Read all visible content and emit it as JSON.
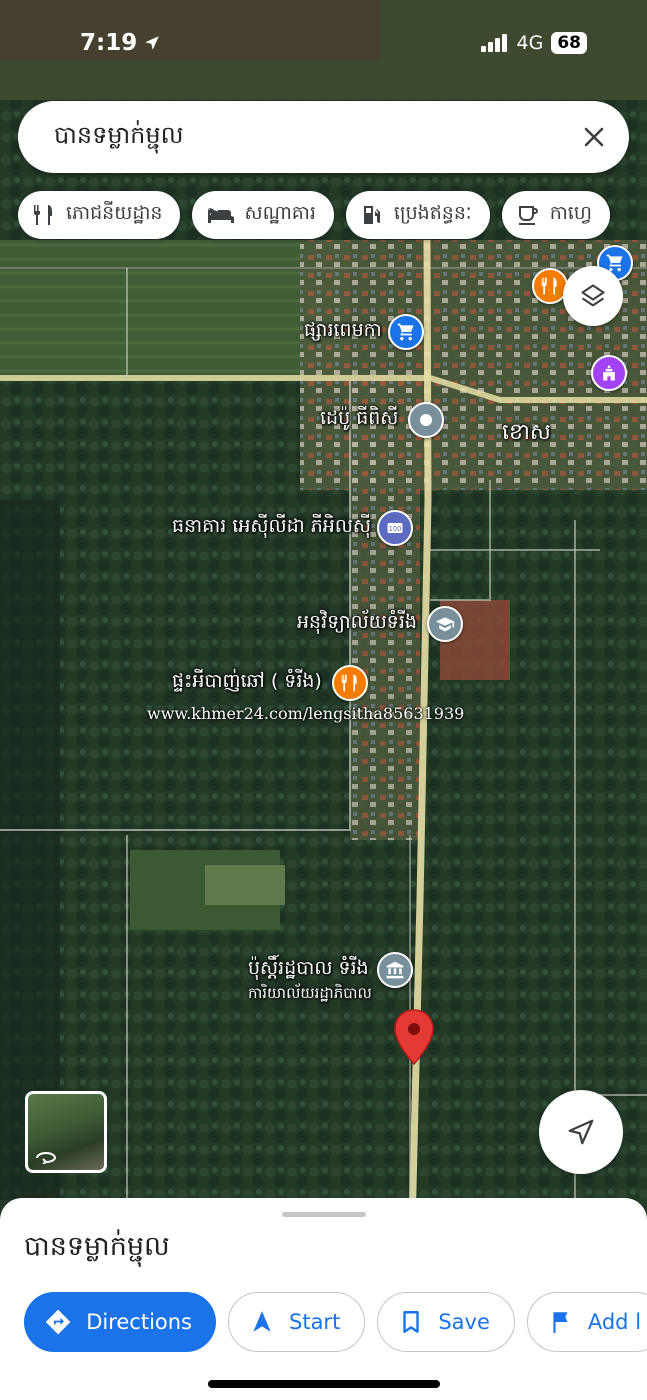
{
  "status_bar": {
    "time": "7:19",
    "network": "4G",
    "battery": "68"
  },
  "search": {
    "query": "បានទម្លាក់ម្ជុល"
  },
  "chips": [
    {
      "label": "ភោជនីយដ្ឋាន",
      "icon": "restaurant-icon"
    },
    {
      "label": "សណ្ឋាគារ",
      "icon": "hotel-icon"
    },
    {
      "label": "ប្រេងឥន្ធនៈ",
      "icon": "gas-station-icon"
    },
    {
      "label": "កាហ្វេ",
      "icon": "coffee-icon"
    }
  ],
  "map": {
    "pois": {
      "market": "ផ្សារពេមកា",
      "depot": "ដេប៉ូ ធីពិសី",
      "area": "ខោស",
      "bank": "ធនាគារ អេស៊ីលីដា ភីអិលស៊ី",
      "school": "អនុវិទ្យាល័យទំរីង",
      "restaurant": "ផ្ទះអីបាញ់ឆៅ ( ទំរីង)",
      "police_post": "ប៉ុស្តិ៍រដ្ឋបាល ទំរីង",
      "police_sub": "ការិយាល័យរដ្ឋាភិបាល"
    },
    "watermark": "www.khmer24.com/lengsitha85631939",
    "colors": {
      "restaurant": "#f57c00",
      "shop": "#1a73e8",
      "civic": "#78909c",
      "worship": "#a142f4",
      "dropped_pin": "#e53935"
    }
  },
  "sheet": {
    "title": "បានទម្លាក់ម្ជុល",
    "actions": {
      "directions": "Directions",
      "start": "Start",
      "save": "Save",
      "add": "Add l"
    }
  }
}
